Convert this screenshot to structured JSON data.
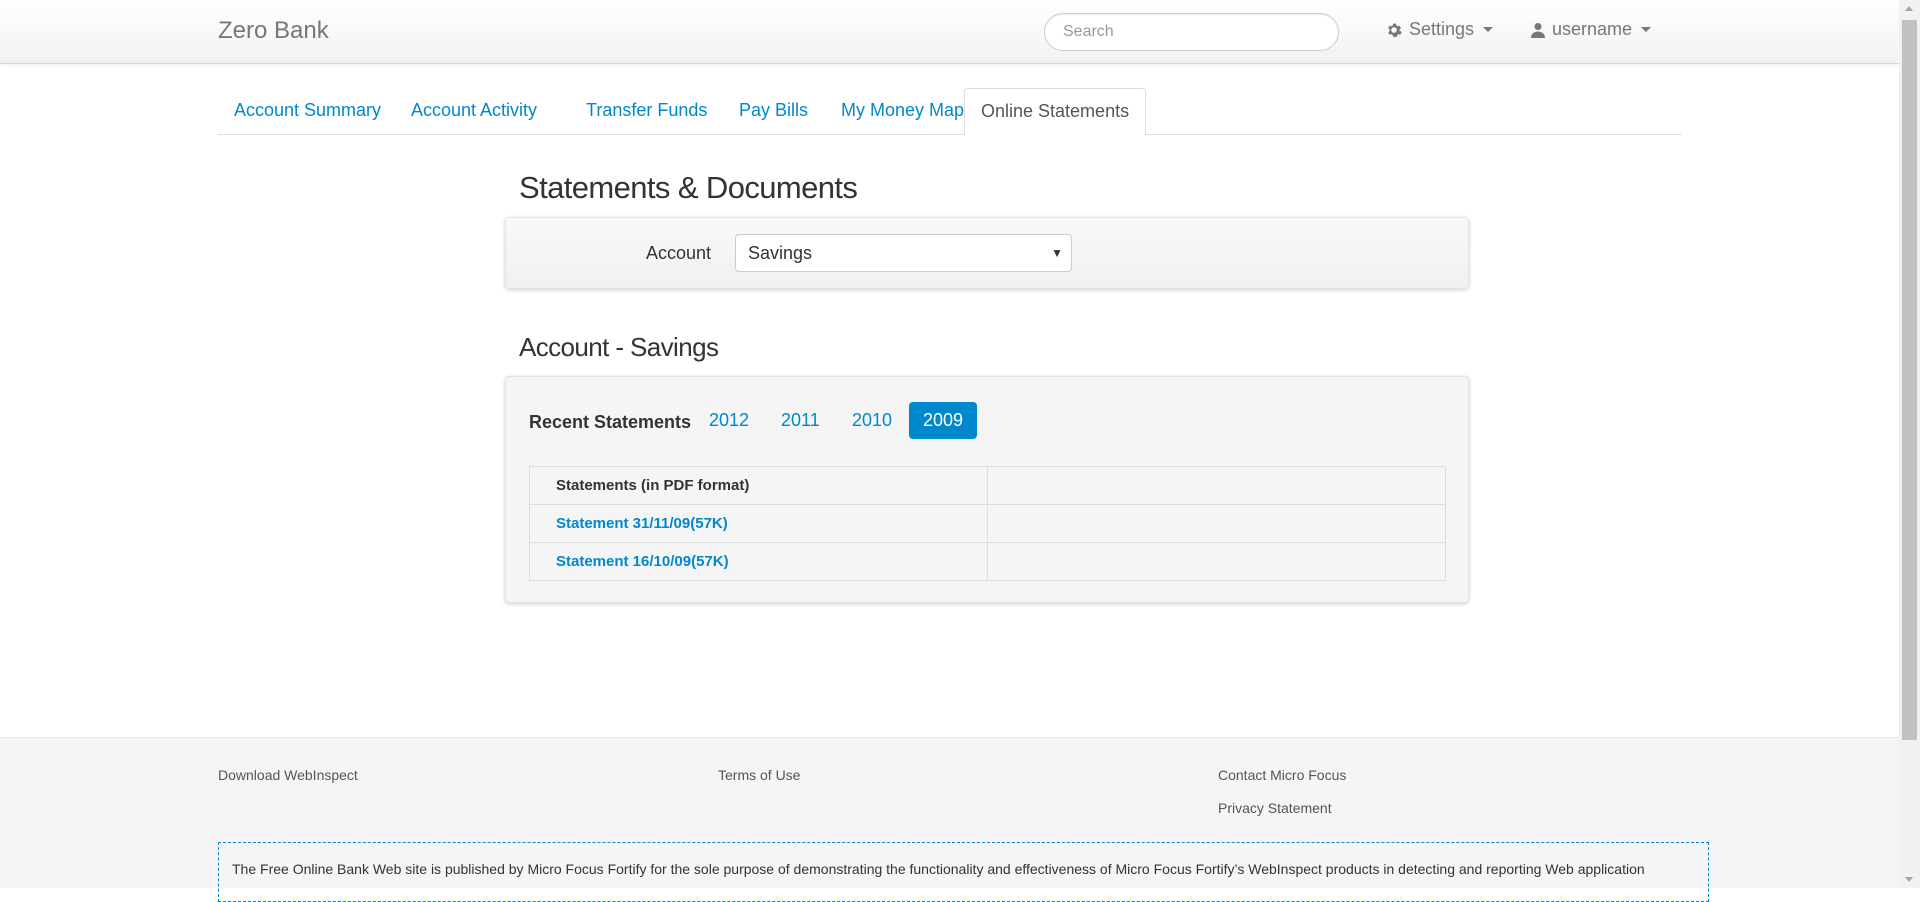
{
  "navbar": {
    "brand": "Zero Bank",
    "search_placeholder": "Search",
    "settings_label": "Settings",
    "user_label": "username",
    "settings_icon": "gear-icon",
    "user_icon": "user-icon"
  },
  "tabs": [
    {
      "label": "Account Summary",
      "active": false
    },
    {
      "label": "Account Activity",
      "active": false
    },
    {
      "label": "Transfer Funds",
      "active": false
    },
    {
      "label": "Pay Bills",
      "active": false
    },
    {
      "label": "My Money Map",
      "active": false
    },
    {
      "label": "Online Statements",
      "active": true
    }
  ],
  "statements": {
    "title": "Statements & Documents",
    "account_label": "Account",
    "account_selected": "Savings",
    "section_title": "Account - Savings",
    "recent_label": "Recent Statements",
    "years": [
      {
        "label": "2012",
        "active": false
      },
      {
        "label": "2011",
        "active": false
      },
      {
        "label": "2010",
        "active": false
      },
      {
        "label": "2009",
        "active": true
      }
    ],
    "table_header": "Statements (in PDF format)",
    "rows": [
      {
        "link": "Statement 31/11/09(57K)"
      },
      {
        "link": "Statement 16/10/09(57K)"
      }
    ]
  },
  "footer": {
    "download": "Download WebInspect",
    "terms": "Terms of Use",
    "contact": "Contact Micro Focus",
    "privacy": "Privacy Statement",
    "disclaimer": "The Free Online Bank Web site is published by Micro Focus Fortify for the sole purpose of demonstrating the functionality and effectiveness of Micro Focus Fortify’s WebInspect products in detecting and reporting Web application"
  },
  "colors": {
    "link": "#0088cc",
    "active_pill": "#0088cc",
    "muted": "#777777"
  }
}
